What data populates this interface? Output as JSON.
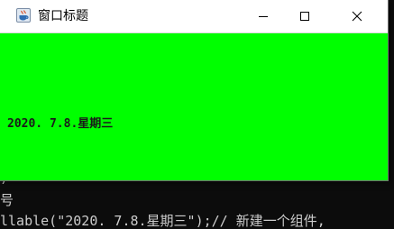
{
  "window": {
    "title": "窗口标题",
    "icon": "java-coffee-cup-icon",
    "content_background": "#00ff00",
    "controls": {
      "minimize_icon": "minimize-icon",
      "maximize_icon": "maximize-icon",
      "close_icon": "close-icon"
    }
  },
  "content": {
    "date_label": "2020. 7.8.星期三"
  },
  "console": {
    "lines": [
      ")",
      ")",
      ")",
      ")",
      ")",
      ")",
      "号",
      "llable(\"2020. 7.8.星期三\");// 新建一个组件,"
    ]
  }
}
